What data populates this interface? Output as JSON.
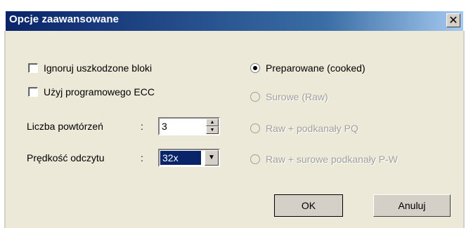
{
  "window": {
    "title": "Opcje zaawansowane",
    "close_glyph": "✕"
  },
  "options": {
    "ignore_bad_blocks": {
      "label": "Ignoruj uszkodzone bloki",
      "checked": false
    },
    "use_software_ecc": {
      "label": "Użyj programowego ECC",
      "checked": false
    }
  },
  "retries": {
    "label": "Liczba powtórzeń",
    "colon": ":",
    "value": "3"
  },
  "read_speed": {
    "label": "Prędkość odczytu",
    "colon": ":",
    "value": "32x",
    "arrow": "▼"
  },
  "read_mode": [
    {
      "label": "Preparowane (cooked)",
      "selected": true,
      "enabled": true
    },
    {
      "label": "Surowe (Raw)",
      "selected": false,
      "enabled": false
    },
    {
      "label": "Raw + podkanały PQ",
      "selected": false,
      "enabled": false
    },
    {
      "label": "Raw + surowe podkanały P-W",
      "selected": false,
      "enabled": false
    }
  ],
  "buttons": {
    "ok_label": "OK",
    "cancel_label": "Anuluj"
  }
}
